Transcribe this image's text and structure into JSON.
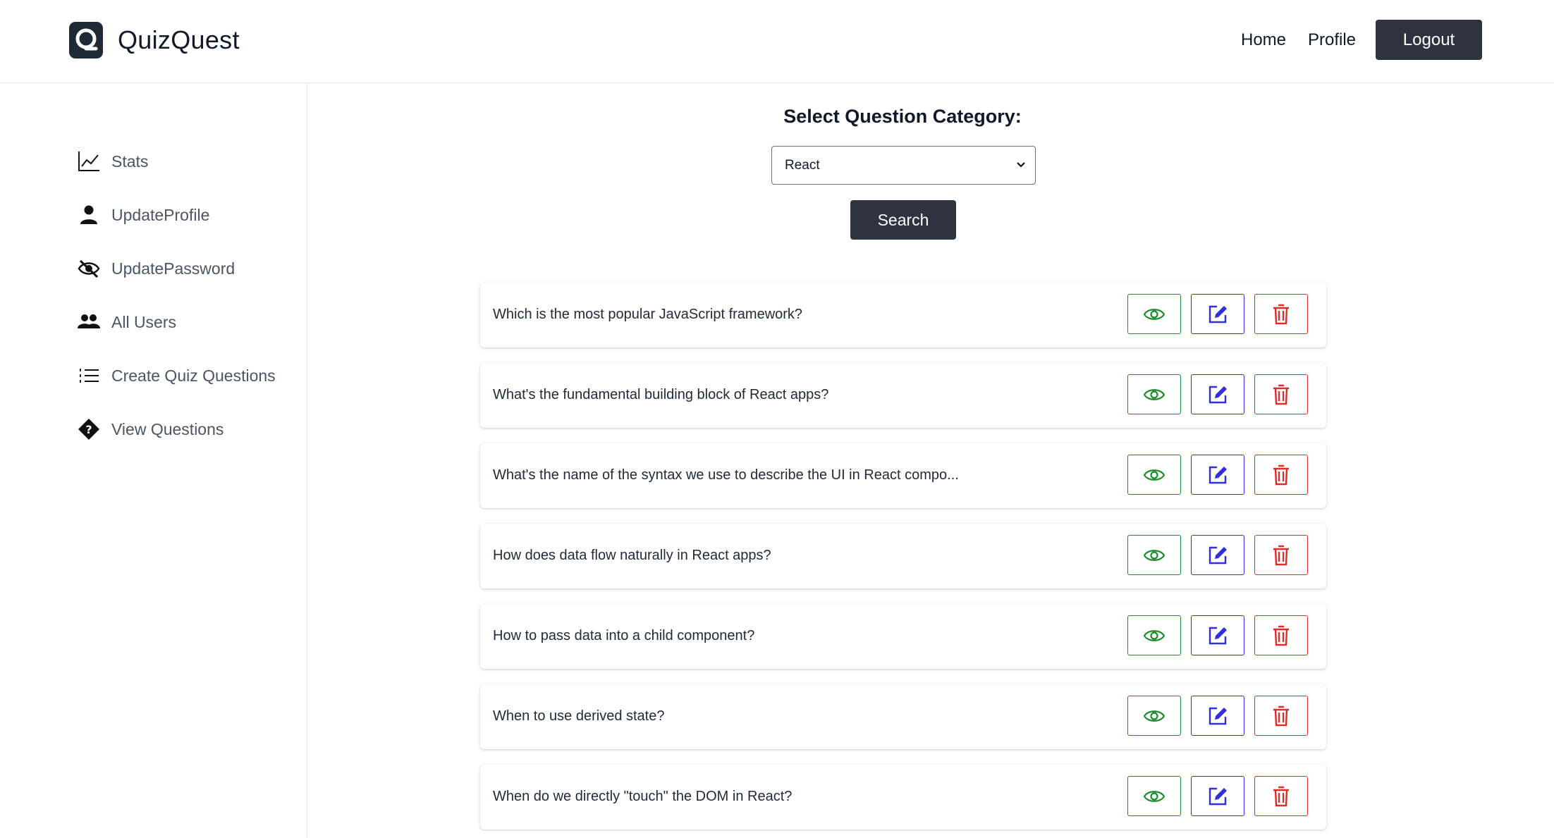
{
  "app": {
    "title": "QuizQuest",
    "logo_icon": "quiz-logo-icon"
  },
  "nav": {
    "home": "Home",
    "profile": "Profile",
    "logout": "Logout"
  },
  "sidebar": {
    "items": [
      {
        "label": "Stats",
        "icon": "line-chart-icon"
      },
      {
        "label": "UpdateProfile",
        "icon": "user-icon"
      },
      {
        "label": "UpdatePassword",
        "icon": "eye-slash-icon"
      },
      {
        "label": "All Users",
        "icon": "users-icon"
      },
      {
        "label": "Create Quiz Questions",
        "icon": "list-icon"
      },
      {
        "label": "View Questions",
        "icon": "question-diamond-icon"
      }
    ]
  },
  "main": {
    "category_title": "Select Question Category:",
    "category_selected": "React",
    "search_label": "Search",
    "questions": [
      "Which is the most popular JavaScript framework?",
      "What's the fundamental building block of React apps?",
      "What's the name of the syntax we use to describe the UI in React compo...",
      "How does data flow naturally in React apps?",
      "How to pass data into a child component?",
      "When to use derived state?",
      "When do we directly \"touch\" the DOM in React?"
    ],
    "actions": {
      "view_icon": "eye-icon",
      "edit_icon": "edit-icon",
      "delete_icon": "trash-icon"
    }
  },
  "colors": {
    "dark": "#2d3440",
    "view": "#1f8a2e",
    "edit": "#2f2fe0",
    "delete": "#e12b2b"
  }
}
